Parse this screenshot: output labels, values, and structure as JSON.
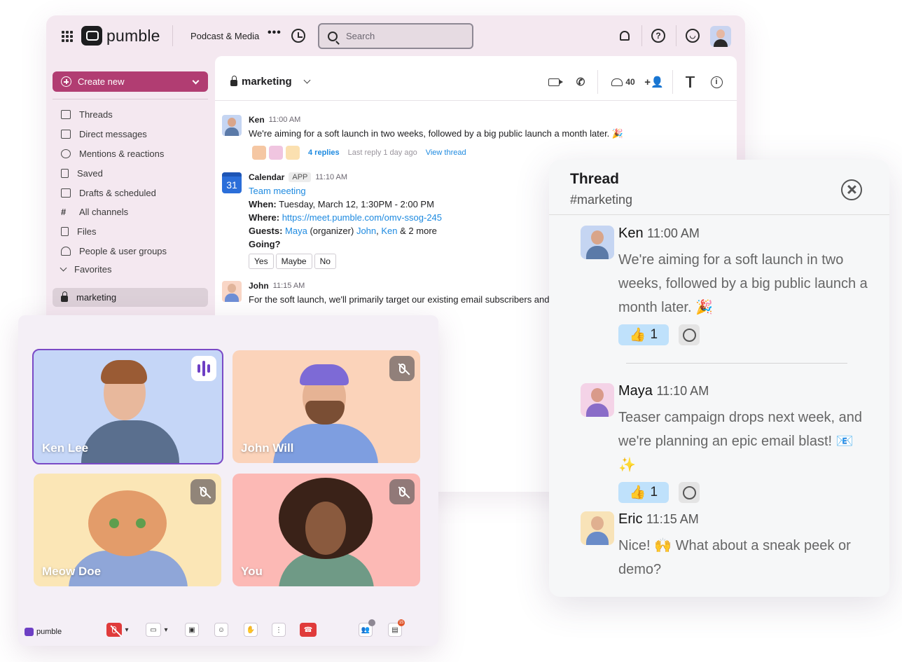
{
  "app": {
    "brand": "pumble",
    "workspace": "Podcast & Media",
    "search_placeholder": "Search"
  },
  "sidebar": {
    "create_new": "Create new",
    "items": [
      {
        "label": "Threads",
        "icon": "threads-icon"
      },
      {
        "label": "Direct messages",
        "icon": "dm-icon"
      },
      {
        "label": "Mentions & reactions",
        "icon": "at-icon"
      },
      {
        "label": "Saved",
        "icon": "bookmark-icon"
      },
      {
        "label": "Drafts & scheduled",
        "icon": "drafts-icon"
      },
      {
        "label": "All channels",
        "icon": "hash-icon"
      },
      {
        "label": "Files",
        "icon": "file-icon"
      },
      {
        "label": "People & user groups",
        "icon": "people-icon"
      }
    ],
    "favorites_label": "Favorites",
    "active_channel": "marketing"
  },
  "channel": {
    "name": "marketing",
    "member_count": "40",
    "messages": [
      {
        "name": "Ken",
        "time": "11:00 AM",
        "text": "We're aiming for a soft launch in two weeks, followed by a big public launch a month later. 🎉",
        "replies": "4 replies",
        "last_reply": "Last reply 1 day ago",
        "view_thread": "View thread"
      },
      {
        "name": "Calendar",
        "tag": "APP",
        "time": "11:10 AM",
        "event_title": "Team meeting",
        "when_label": "When:",
        "when_value": "Tuesday, March 12, 1:30PM - 2:00 PM",
        "where_label": "Where:",
        "where_value": "https://meet.pumble.com/omv-ssog-245",
        "guests_label": "Guests:",
        "guest1": "Maya",
        "guest1_role": "(organizer)",
        "guest2": "John",
        "guest3": "Ken",
        "guests_more": "& 2 more",
        "going": "Going?",
        "rsvp": [
          "Yes",
          "Maybe",
          "No"
        ],
        "calendar_day": "31"
      },
      {
        "name": "John",
        "time": "11:15 AM",
        "text": "For the soft launch, we'll primarily target our existing email subscribers and"
      }
    ]
  },
  "call": {
    "participants": [
      {
        "name": "Ken Lee",
        "speaking": true,
        "muted": false
      },
      {
        "name": "John Will",
        "speaking": false,
        "muted": true
      },
      {
        "name": "Meow Doe",
        "speaking": false,
        "muted": true
      },
      {
        "name": "You",
        "speaking": false,
        "muted": true
      }
    ],
    "brand": "pumble",
    "participants_badge": "",
    "chat_badge": "15"
  },
  "thread": {
    "title": "Thread",
    "channel": "#marketing",
    "messages": [
      {
        "name": "Ken",
        "time": "11:00 AM",
        "text": "We're aiming for a soft launch in two weeks, followed by a big public launch a month later. 🎉",
        "reaction": "👍",
        "count": "1"
      },
      {
        "name": "Maya",
        "time": "11:10 AM",
        "text": "Teaser campaign drops next week, and we're planning an epic email blast! 📧✨",
        "reaction": "👍",
        "count": "1"
      },
      {
        "name": "Eric",
        "time": "11:15 AM",
        "text": "Nice! 🙌 What about a sneak peek or demo?"
      }
    ]
  },
  "colors": {
    "accent": "#b13d72",
    "link": "#1e8ae0",
    "speaking": "#6d3fc4",
    "end_call": "#e03b3b"
  }
}
